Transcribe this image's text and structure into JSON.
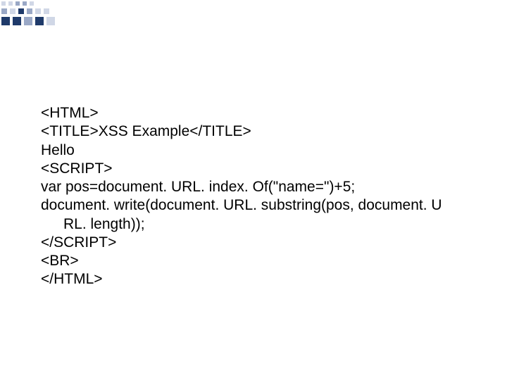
{
  "code": {
    "l1": "<HTML>",
    "l2": "<TITLE>XSS Example</TITLE>",
    "l3": "Hello",
    "l4": "<SCRIPT>",
    "l5": "var pos=document. URL. index. Of(\"name=\")+5;",
    "l6": "document. write(document. URL. substring(pos, document. U",
    "l7": "RL. length));",
    "l8": "</SCRIPT>",
    "l9": "<BR>",
    "l10": "</HTML>"
  },
  "deco": {
    "dark": "#1f3a6a",
    "mid": "#9aa8c6",
    "light": "#d0d7e6"
  }
}
